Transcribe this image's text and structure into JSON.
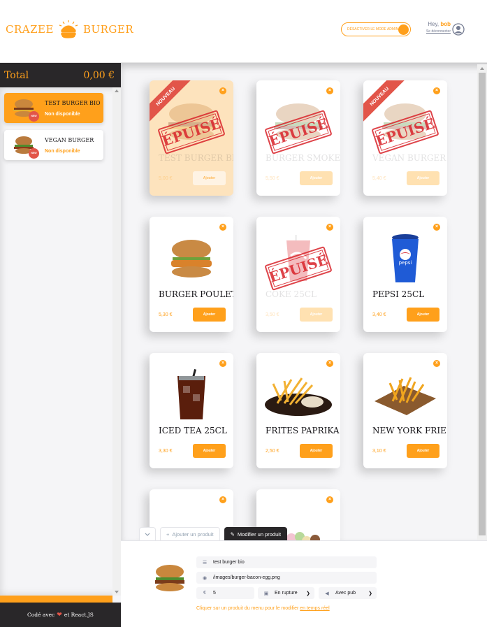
{
  "header": {
    "logo_left": "CRAZEE",
    "logo_right": "BURGER",
    "admin_toggle_label": "DÉSACTIVER LE MODE ADMIN",
    "greeting": "Hey,",
    "username": "bob",
    "logout_label": "Se déconnecter"
  },
  "basket": {
    "total_label": "Total",
    "total_value": "0,00 €",
    "items": [
      {
        "name": "TEST BURGER BIO",
        "status": "Non disponible",
        "badge": "NEW"
      },
      {
        "name": "VEGAN BURGER",
        "status": "Non disponible",
        "badge": "NEW"
      }
    ],
    "footer_prefix": "Codé avec",
    "footer_suffix": "et React.JS"
  },
  "menu": {
    "ribbon_label": "NOUVEAU",
    "soldout_label": "ÉPUISÉ",
    "add_label": "Ajouter",
    "cards": [
      {
        "title": "TEST BURGER BIO",
        "price": "5,00 €"
      },
      {
        "title": "BURGER SMOKE BBQ",
        "price": "5,50 €"
      },
      {
        "title": "VEGAN BURGER",
        "price": "5,40 €"
      },
      {
        "title": "BURGER POULET",
        "price": "5,30 €"
      },
      {
        "title": "COKE 25CL",
        "price": "3,50 €"
      },
      {
        "title": "PEPSI 25CL",
        "price": "3,40 €"
      },
      {
        "title": "ICED TEA 25CL",
        "price": "3,30 €"
      },
      {
        "title": "FRITES PAPRIKA",
        "price": "2,50 €"
      },
      {
        "title": "NEW YORK FRIES",
        "price": "3,10 €"
      }
    ],
    "pepsi_text": "pepsi"
  },
  "admin": {
    "tab_add": "Ajouter un produit",
    "tab_edit": "Modifier un produit",
    "name_value": "test burger bio",
    "image_value": "/images/burger-bacon-egg.png",
    "price_value": "5",
    "stock_value": "En rupture",
    "pub_value": "Avec pub",
    "hint_text": "Cliquer sur un produit du menu pour le modifier ",
    "hint_link": "en temps réel"
  },
  "colors": {
    "primary": "#ffa01b",
    "dark": "#292729",
    "red": "#e25549",
    "background": "#f5f5f7"
  }
}
